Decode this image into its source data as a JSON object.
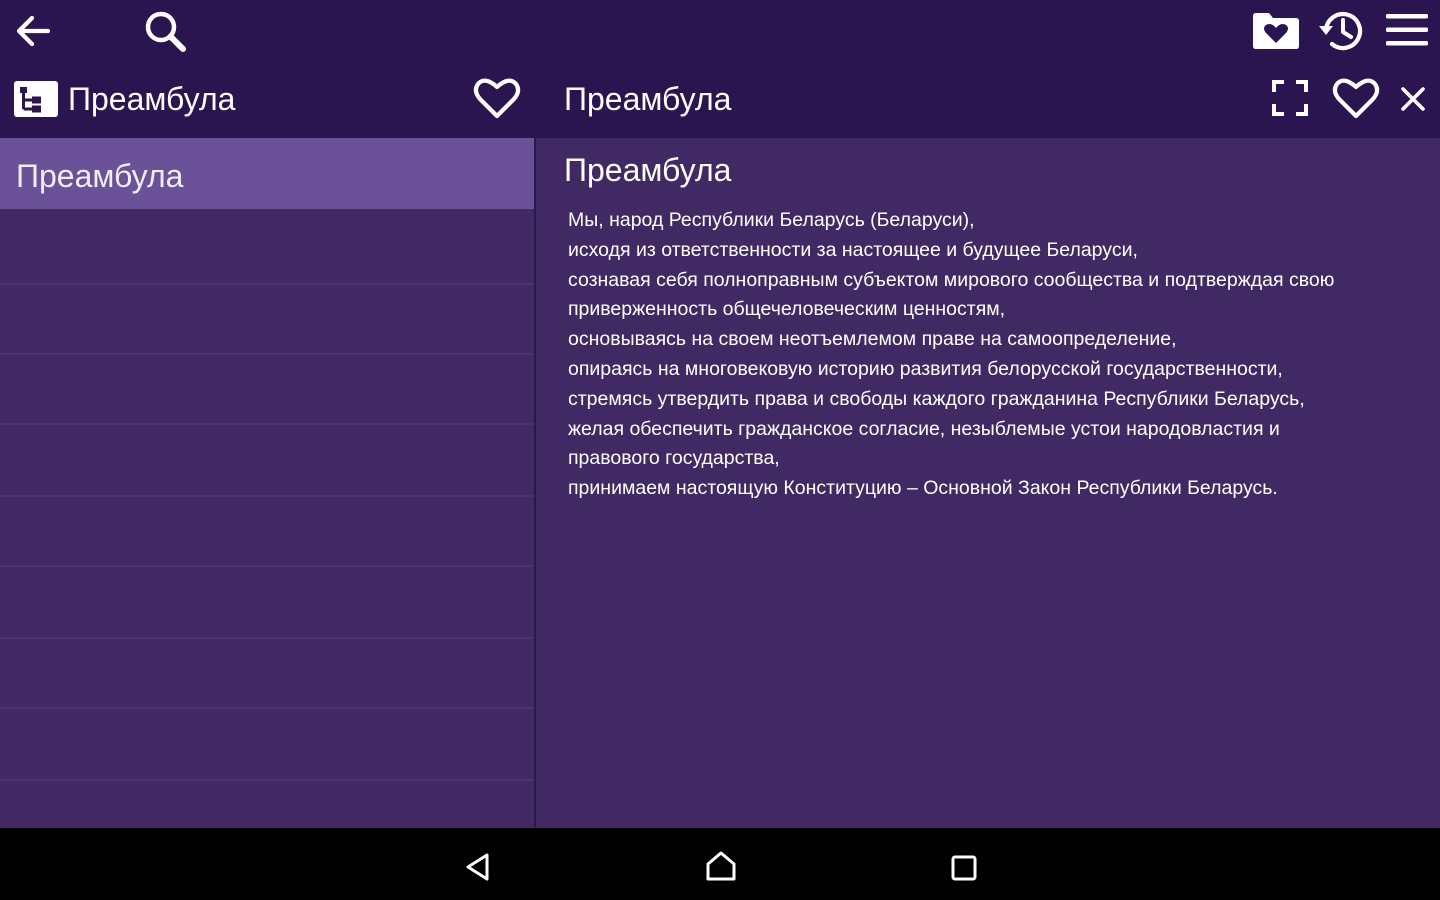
{
  "toolbar": {
    "back_icon": "arrow-left-icon",
    "search_icon": "search-icon",
    "favorites_folder_icon": "folder-heart-icon",
    "history_icon": "history-icon",
    "menu_icon": "menu-icon"
  },
  "left_pane": {
    "title": "Преамбула",
    "tree_icon": "tree-structure-icon",
    "favorite_icon": "heart-outline-icon",
    "items": [
      {
        "label": "Преамбула",
        "selected": true
      }
    ]
  },
  "right_pane": {
    "title": "Преамбула",
    "fullscreen_icon": "fullscreen-icon",
    "favorite_icon": "heart-outline-icon",
    "close_icon": "close-icon",
    "heading": "Преамбула",
    "lines": [
      "Мы, народ Республики Беларусь (Беларуси),",
      "исходя из ответственности за настоящее и будущее Беларуси,",
      "сознавая себя полноправным субъектом мирового сообщества и подтверждая свою",
      "приверженность общечеловеческим ценностям,",
      "основываясь на своем неотъемлемом праве на самоопределение,",
      "опираясь на многовековую историю развития белорусской государственности,",
      "стремясь утвердить права и свободы каждого гражданина Республики Беларусь,",
      "желая обеспечить гражданское согласие, незыблемые устои народовластия и",
      "правового государства,",
      "принимаем настоящую Конституцию – Основной Закон Республики Беларусь."
    ]
  },
  "navbar": {
    "back_icon": "nav-back-icon",
    "home_icon": "nav-home-icon",
    "recents_icon": "nav-recents-icon"
  },
  "colors": {
    "toolbar_bg": "#2b1550",
    "panel_bg": "#412a63",
    "selected_row_bg": "#6b5198",
    "navbar_bg": "#000000"
  }
}
